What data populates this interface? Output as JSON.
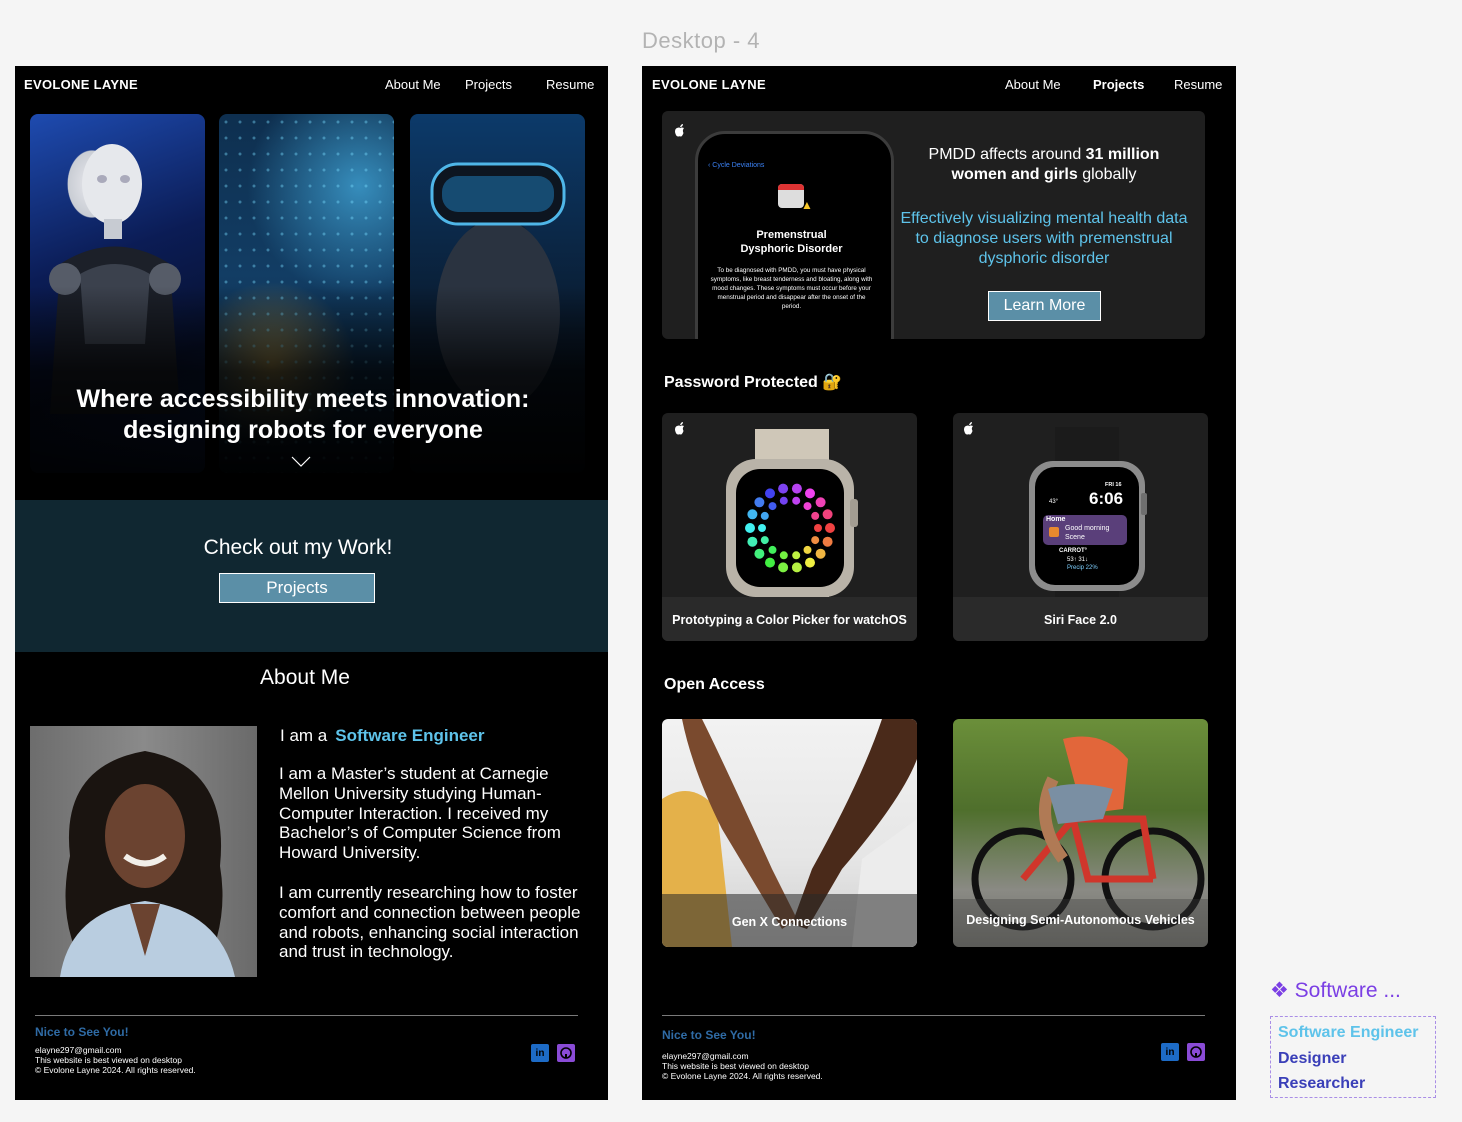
{
  "canvas": {
    "frame_label": "Desktop - 4"
  },
  "home": {
    "brand": "EVOLONE LAYNE",
    "nav": [
      "About Me",
      "Projects",
      "Resume"
    ],
    "hero_title_line1": "Where accessibility meets innovation:",
    "hero_title_line2": "designing robots for everyone",
    "work_title": "Check out my Work!",
    "work_button": "Projects",
    "about_title": "About Me",
    "intro_prefix": "I am a",
    "intro_role": "Software Engineer",
    "bio_1": "I am a Master’s student at Carnegie Mellon University studying Human-Computer Interaction. I received my Bachelor’s of Computer Science from Howard University.",
    "bio_2": "I am currently researching how to foster comfort and connection between people and robots, enhancing social interaction and trust in technology."
  },
  "projects_page": {
    "brand": "EVOLONE LAYNE",
    "nav": [
      "About Me",
      "Projects",
      "Resume"
    ],
    "active_nav": "Projects",
    "feature": {
      "phone_back": "Cycle Deviations",
      "phone_title_1": "Premenstrual",
      "phone_title_2": "Dysphoric Disorder",
      "phone_body": "To be diagnosed with PMDD, you must have physical symptoms, like breast tenderness and bloating, along with mood changes. These symptoms must occur before your menstrual period and disappear after the onset of the period.",
      "headline_pre": "PMDD affects around ",
      "headline_bold1": "31 million",
      "headline_bold2": "women and girls",
      "headline_post": " globally",
      "subline": "Effectively visualizing mental health data to diagnose users with premenstrual dysphoric disorder",
      "button": "Learn More"
    },
    "password_heading": "Password Protected 🔐",
    "protected_cards": [
      {
        "label": "Prototyping a Color Picker for watchOS"
      },
      {
        "label": "Siri Face 2.0",
        "watch_date": "FRI 16",
        "watch_time": "6:06",
        "watch_temp": "43°",
        "watch_home": "Home",
        "watch_scene": "Good morning Scene",
        "watch_weather": "CARROT°",
        "watch_range": "53↑ 31↓",
        "watch_precip": "Precip 22%"
      }
    ],
    "open_heading": "Open Access",
    "open_cards": [
      {
        "label": "Gen X Connections"
      },
      {
        "label": "Designing Semi-Autonomous Vehicles"
      }
    ]
  },
  "footer": {
    "heading": "Nice to See You!",
    "email": "elayne297@gmail.com",
    "note": "This website is best viewed on desktop",
    "copyright": "© Evolone Layne 2024. All rights reserved."
  },
  "component_panel": {
    "title": "Software ...",
    "items": [
      "Software Engineer",
      "Designer",
      "Researcher"
    ]
  },
  "colors": {
    "accent": "#5ec3ea",
    "button": "#5b8fa7",
    "band": "#102731",
    "footer_heading": "#2f6ba5",
    "linkedin": "#1d6bc6",
    "github": "#8a4bd6",
    "component": "#7b3fe4"
  }
}
